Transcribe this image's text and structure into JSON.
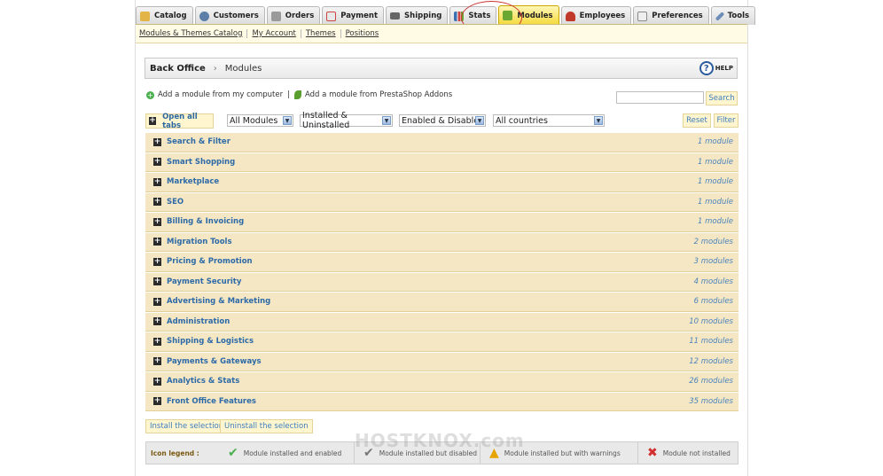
{
  "tabs": [
    {
      "label": "Catalog",
      "icon": "folder-icon",
      "color": "#e3b548"
    },
    {
      "label": "Customers",
      "icon": "user-icon",
      "color": "#5b7fa8"
    },
    {
      "label": "Orders",
      "icon": "cart-icon",
      "color": "#9a9a9a"
    },
    {
      "label": "Payment",
      "icon": "payment-icon",
      "color": "#c44"
    },
    {
      "label": "Shipping",
      "icon": "truck-icon",
      "color": "#666"
    },
    {
      "label": "Stats",
      "icon": "chart-icon",
      "color": "#3b6fb0"
    },
    {
      "label": "Modules",
      "icon": "puzzle-icon",
      "color": "#6aa832"
    },
    {
      "label": "Employees",
      "icon": "employee-icon",
      "color": "#c0392b"
    },
    {
      "label": "Preferences",
      "icon": "preferences-icon",
      "color": "#8a8a8a"
    },
    {
      "label": "Tools",
      "icon": "wrench-icon",
      "color": "#6c8db8"
    }
  ],
  "subnav": [
    "Modules & Themes Catalog",
    "My Account",
    "Themes",
    "Positions"
  ],
  "breadcrumb": {
    "root": "Back Office",
    "separator": "›",
    "current": "Modules",
    "help": "HELP"
  },
  "add_links": {
    "local": "Add a module from my computer",
    "separator": "|",
    "addons": "Add a module from PrestaShop Addons"
  },
  "search": {
    "value": "",
    "button": "Search"
  },
  "filters": {
    "open_all": "Open all tabs",
    "type": "All Modules",
    "install": "Installed & Uninstalled",
    "status": "Enabled & Disabled",
    "country": "All countries",
    "reset": "Reset",
    "filter": "Filter"
  },
  "categories": [
    {
      "name": "Search & Filter",
      "count": "1 module"
    },
    {
      "name": "Smart Shopping",
      "count": "1 module"
    },
    {
      "name": "Marketplace",
      "count": "1 module"
    },
    {
      "name": "SEO",
      "count": "1 module"
    },
    {
      "name": "Billing & Invoicing",
      "count": "1 module"
    },
    {
      "name": "Migration Tools",
      "count": "2 modules"
    },
    {
      "name": "Pricing & Promotion",
      "count": "3 modules"
    },
    {
      "name": "Payment Security",
      "count": "4 modules"
    },
    {
      "name": "Advertising & Marketing",
      "count": "6 modules"
    },
    {
      "name": "Administration",
      "count": "10 modules"
    },
    {
      "name": "Shipping & Logistics",
      "count": "11 modules"
    },
    {
      "name": "Payments & Gateways",
      "count": "12 modules"
    },
    {
      "name": "Analytics & Stats",
      "count": "26 modules"
    },
    {
      "name": "Front Office Features",
      "count": "35 modules"
    }
  ],
  "bottom_buttons": {
    "install": "Install the selection",
    "uninstall": "Uninstall the selection"
  },
  "legend": {
    "title": "Icon legend :",
    "items": [
      {
        "label": "Module installed and enabled",
        "icon": "check-green-icon",
        "color": "#4caf50"
      },
      {
        "label": "Module installed but disabled",
        "icon": "check-grey-icon",
        "color": "#777"
      },
      {
        "label": "Module installed but with warnings",
        "icon": "warning-icon",
        "color": "#e6a400"
      },
      {
        "label": "Module not installed",
        "icon": "cross-red-icon",
        "color": "#d32f2f"
      }
    ]
  },
  "watermark": "HOSTKNOX.com",
  "colors": {
    "accent_tab": "#f5d93a",
    "category_bg": "#f5e7c4",
    "link_blue": "#2d6aa7"
  }
}
